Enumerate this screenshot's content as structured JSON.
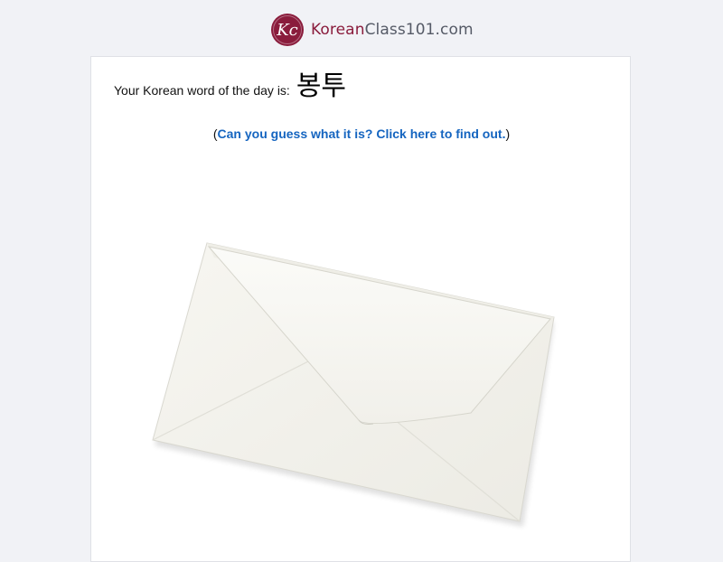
{
  "brand": {
    "name_accent": "Korean",
    "name_rest": "Class101.com",
    "logo_glyph": "Kc",
    "accent_color": "#8a1c3c"
  },
  "word_of_day": {
    "label": "Your Korean word of the day is:",
    "word": "봉투"
  },
  "guess": {
    "open_paren": "(",
    "link_text": "Can you guess what it is? Click here to find out.",
    "close_paren": ")",
    "link_color": "#1565c0"
  },
  "image": {
    "icon": "envelope-image"
  }
}
